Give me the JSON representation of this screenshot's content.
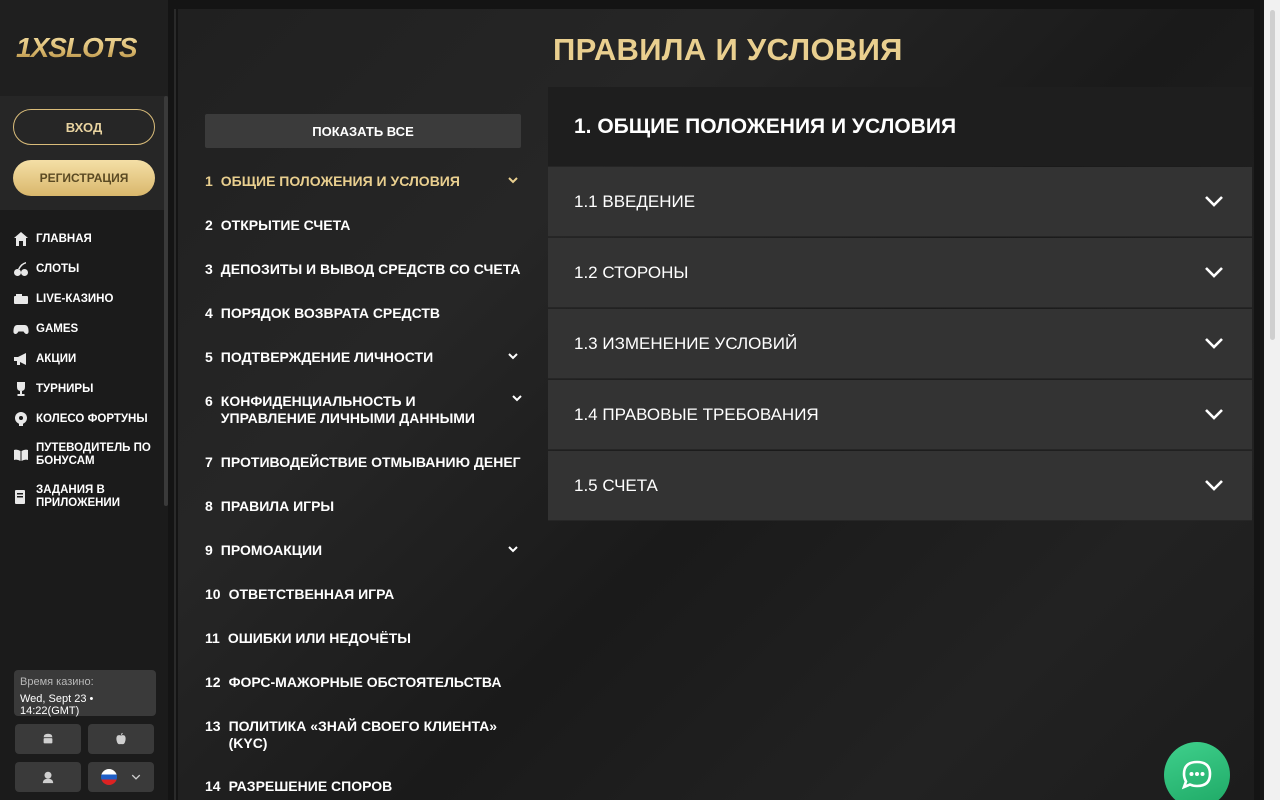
{
  "app": {
    "logo": "1XSLOTS"
  },
  "auth": {
    "login": "ВХОД",
    "register": "РЕГИСТРАЦИЯ"
  },
  "nav": [
    {
      "label": "ГЛАВНАЯ",
      "icon": "home-icon"
    },
    {
      "label": "СЛОТЫ",
      "icon": "cherry-icon"
    },
    {
      "label": "LIVE-КАЗИНО",
      "icon": "live-casino-icon"
    },
    {
      "label": "GAMES",
      "icon": "gamepad-icon"
    },
    {
      "label": "АКЦИИ",
      "icon": "megaphone-icon"
    },
    {
      "label": "ТУРНИРЫ",
      "icon": "trophy-icon"
    },
    {
      "label": "КОЛЕСО ФОРТУНЫ",
      "icon": "wheel-icon"
    },
    {
      "label": "ПУТЕВОДИТЕЛЬ ПО БОНУСАМ",
      "icon": "book-icon"
    },
    {
      "label": "ЗАДАНИЯ В ПРИЛОЖЕНИИ",
      "icon": "tasks-icon"
    }
  ],
  "time": {
    "title": "Время казино:",
    "value": "Wed, Sept 23 • 14:22(GMT)"
  },
  "page": {
    "title": "ПРАВИЛА И УСЛОВИЯ",
    "show_all": "ПОКАЗАТЬ ВСЕ"
  },
  "toc": [
    {
      "num": "1",
      "label": "ОБЩИЕ ПОЛОЖЕНИЯ И УСЛОВИЯ",
      "active": true,
      "expandable": true
    },
    {
      "num": "2",
      "label": "ОТКРЫТИЕ СЧЕТА"
    },
    {
      "num": "3",
      "label": "ДЕПОЗИТЫ И ВЫВОД СРЕДСТВ СО СЧЕТА"
    },
    {
      "num": "4",
      "label": "ПОРЯДОК ВОЗВРАТА СРЕДСТВ"
    },
    {
      "num": "5",
      "label": "ПОДТВЕРЖДЕНИЕ ЛИЧНОСТИ",
      "expandable": true
    },
    {
      "num": "6",
      "label": "КОНФИДЕНЦИАЛЬНОСТЬ И УПРАВЛЕНИЕ ЛИЧНЫМИ ДАННЫМИ",
      "expandable": true
    },
    {
      "num": "7",
      "label": "ПРОТИВОДЕЙСТВИЕ ОТМЫВАНИЮ ДЕНЕГ"
    },
    {
      "num": "8",
      "label": "ПРАВИЛА ИГРЫ"
    },
    {
      "num": "9",
      "label": "ПРОМОАКЦИИ",
      "expandable": true
    },
    {
      "num": "10",
      "label": "ОТВЕТСТВЕННАЯ ИГРА"
    },
    {
      "num": "11",
      "label": "ОШИБКИ ИЛИ НЕДОЧЁТЫ"
    },
    {
      "num": "12",
      "label": "ФОРС-МАЖОРНЫЕ ОБСТОЯТЕЛЬСТВА"
    },
    {
      "num": "13",
      "label": "ПОЛИТИКА «ЗНАЙ СВОЕГО КЛИЕНТА» (KYC)"
    },
    {
      "num": "14",
      "label": "РАЗРЕШЕНИЕ СПОРОВ"
    }
  ],
  "section": {
    "title": "1. ОБЩИЕ ПОЛОЖЕНИЯ И УСЛОВИЯ",
    "items": [
      {
        "label": "1.1 ВВЕДЕНИЕ"
      },
      {
        "label": "1.2 СТОРОНЫ"
      },
      {
        "label": "1.3 ИЗМЕНЕНИЕ УСЛОВИЙ"
      },
      {
        "label": "1.4 ПРАВОВЫЕ ТРЕБОВАНИЯ"
      },
      {
        "label": "1.5 СЧЕТА"
      }
    ]
  },
  "colors": {
    "accent": "#e9cf8f",
    "panel": "#333333",
    "chat": "#2cc07a"
  }
}
